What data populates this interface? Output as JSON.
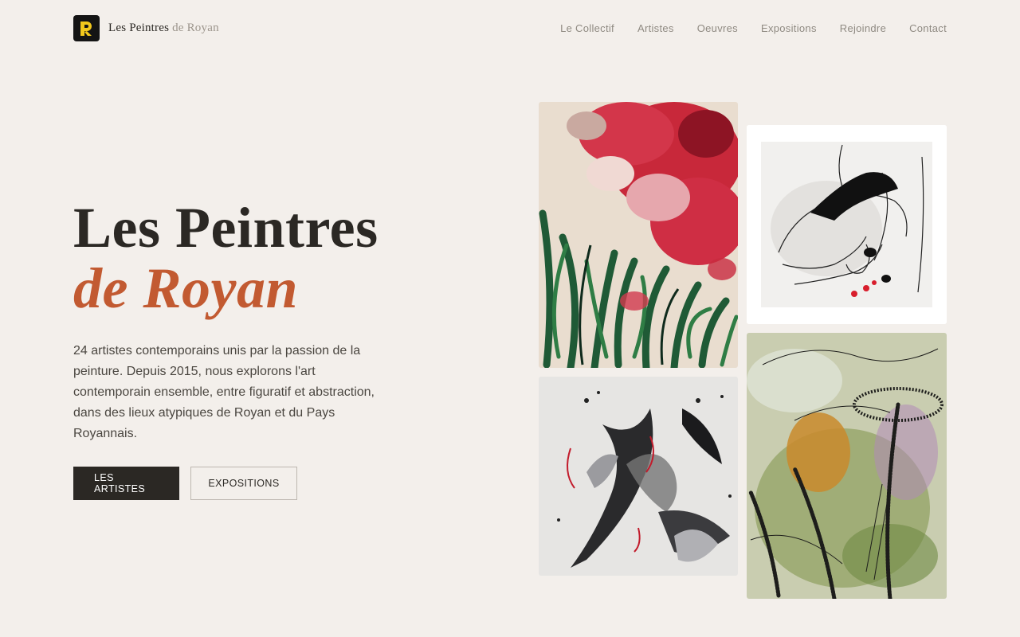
{
  "brand": {
    "logo_icon": "pr-monogram-icon",
    "name_part1": "Les Peintres",
    "name_part2": "de Royan"
  },
  "nav": {
    "items": [
      "Le Collectif",
      "Artistes",
      "Oeuvres",
      "Expositions",
      "Rejoindre",
      "Contact"
    ]
  },
  "hero": {
    "title_line1": "Les Peintres",
    "title_line2": "de Royan",
    "description": "24 artistes contemporains unis par la passion de la peinture. Depuis 2015, nous explorons l'art contemporain ensemble, entre figuratif et abstraction, dans des lieux atypiques de Royan et du Pays Royannais.",
    "primary_button": "LES ARTISTES",
    "secondary_button": "EXPOSITIONS"
  },
  "colors": {
    "background": "#f3efeb",
    "text_dark": "#2b2824",
    "accent": "#c25a31",
    "nav_text": "#8f8a82",
    "logo_yellow": "#f2c81c"
  }
}
